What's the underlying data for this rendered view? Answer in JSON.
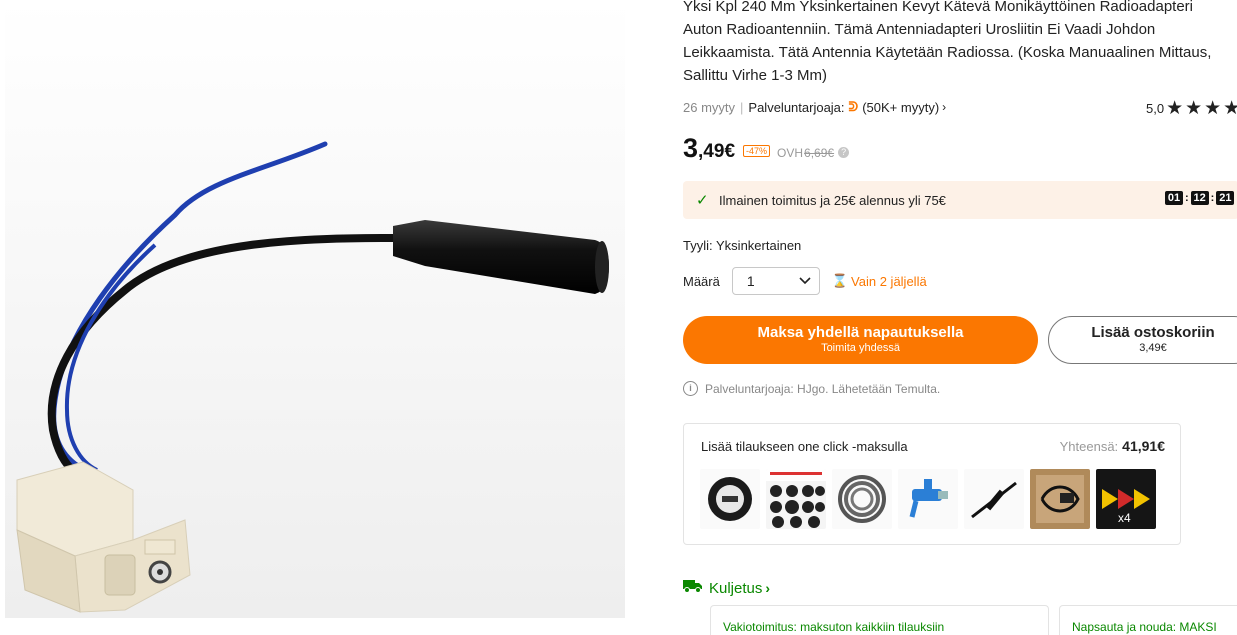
{
  "product": {
    "title": "Yksi Kpl 240 Mm Yksinkertainen Kevyt Kätevä Monikäyttöinen Radioadapteri Auton Radioantenniin. Tämä Antenniadapteri Urosliitin Ei Vaadi Johdon Leikkaamista. Tätä Antennia Käytetään Radiossa. (Koska Manuaalinen Mittaus, Sallittu Virhe 1-3 Mm)",
    "sold": "26 myyty",
    "provider_label": "Palveluntarjoaja:",
    "provider_sales": "(50K+ myyty)",
    "rating": "5,0",
    "star_count": 5
  },
  "price": {
    "main": "3",
    "rest": ",49€",
    "discount": "-47%",
    "orig_label": "OVH",
    "orig_price": "6,69€"
  },
  "shipping_banner": {
    "text": "Ilmainen toimitus ja 25€ alennus yli 75€",
    "timer": [
      "01",
      "12",
      "21"
    ]
  },
  "style": {
    "label": "Tyyli:",
    "value": "Yksinkertainen"
  },
  "quantity": {
    "label": "Määrä",
    "value": "1",
    "stock": "Vain 2 jäljellä"
  },
  "buttons": {
    "buy_main": "Maksa yhdellä napautuksella",
    "buy_sub": "Toimita yhdessä",
    "cart_main": "Lisää ostoskoriin",
    "cart_sub": "3,49€"
  },
  "seller_info": "Palveluntarjoaja: HJgo. Lähetetään Temulta.",
  "bundle": {
    "title": "Lisää tilaukseen one click -maksulla",
    "total_label": "Yhteensä:",
    "total": "41,91€",
    "extra_count": "x4"
  },
  "transport": {
    "title": "Kuljetus",
    "card1": "Vakiotoimitus: maksuton kaikkiin tilauksiin",
    "card2": "Napsauta ja nouda: MAKSI"
  },
  "colors": {
    "accent": "#fb7701",
    "success": "#0a8800",
    "banner_bg": "#fdf1e7"
  }
}
